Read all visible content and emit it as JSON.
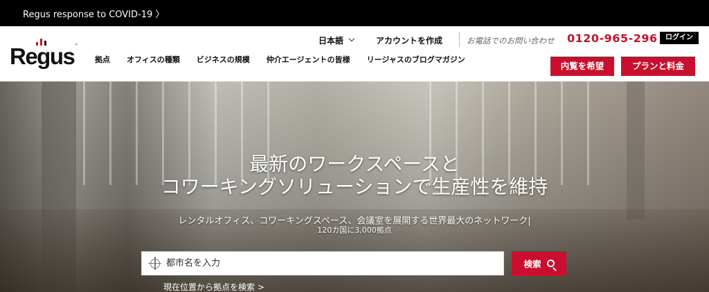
{
  "announcement": {
    "text": "Regus response to COVID-19 〉"
  },
  "brand": {
    "name": "Regus",
    "tm": "™",
    "accent": "#c8102e"
  },
  "utility": {
    "language": "日本語",
    "create_account": "アカウントを作成",
    "phone_label": "お電話でのお問い合わせ",
    "phone_number": "0120-965-296",
    "login": "ログイン"
  },
  "nav": {
    "items": [
      {
        "label": "拠点"
      },
      {
        "label": "オフィスの種類"
      },
      {
        "label": "ビジネスの規模"
      },
      {
        "label": "仲介エージェントの皆様"
      },
      {
        "label": "リージャスのブログマガジン"
      }
    ]
  },
  "cta": {
    "book_visit": "内覧を希望",
    "plans_pricing": "プランと料金"
  },
  "hero": {
    "title_line1": "最新のワークスペースと",
    "title_line2": "コワーキングソリューションで生産性を維持",
    "subtitle_line1": "レンタルオフィス、コワーキングスペース、会議室を展開する世界最大のネットワーク|",
    "subtitle_line2": "120カ国に3,000拠点"
  },
  "search": {
    "placeholder": "都市名を入力",
    "button": "検索",
    "locate_link": "現在位置から拠点を検索 >"
  },
  "icons": [
    "locate-target-icon",
    "search-icon",
    "chevron-down-icon"
  ]
}
